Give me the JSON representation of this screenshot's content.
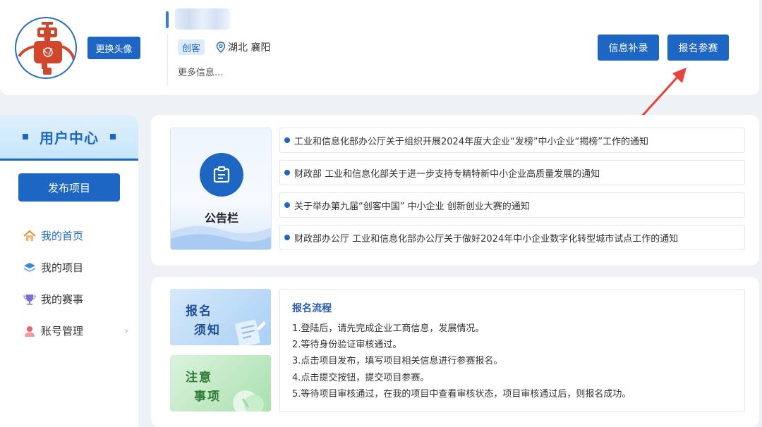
{
  "profile": {
    "change_avatar_label": "更换头像",
    "tag": "创客",
    "location": "湖北 襄阳",
    "more_info": "更多信息...",
    "info_button": "信息补录",
    "signup_button": "报名参赛"
  },
  "sidebar": {
    "title": "用户中心",
    "publish_button": "发布项目",
    "items": [
      {
        "label": "我的首页",
        "icon": "home-icon"
      },
      {
        "label": "我的项目",
        "icon": "layers-icon"
      },
      {
        "label": "我的赛事",
        "icon": "trophy-icon"
      },
      {
        "label": "账号管理",
        "icon": "user-icon"
      }
    ]
  },
  "notice": {
    "title": "公告栏",
    "items": [
      "工业和信息化部办公厅关于组织开展2024年度大企业“发榜”中小企业“揭榜”工作的通知",
      "财政部 工业和信息化部关于进一步支持专精特新中小企业高质量发展的通知",
      "关于举办第九届“创客中国” 中小企业 创新创业大赛的通知",
      "财政部办公厅 工业和信息化部办公厅关于做好2024年中小企业数字化转型城市试点工作的通知"
    ]
  },
  "registration": {
    "tile1_line1": "报名",
    "tile1_line2": "须知",
    "tile2_line1": "注意",
    "tile2_line2": "事项",
    "process_title": "报名流程",
    "steps": [
      "1.登陆后，请先完成企业工商信息，发展情况。",
      "2.等待身份验证审核通过。",
      "3.点击项目发布，填写项目相关信息进行参赛报名。",
      "4.点击提交按钮，提交项目参赛。",
      "5.等待项目审核通过，在我的项目中查看审核状态，项目审核通过后，则报名成功。"
    ]
  },
  "colors": {
    "primary": "#1e66c4",
    "background": "#eef1f6",
    "tag_bg": "#dcebfd",
    "arrow": "#e8423a"
  }
}
